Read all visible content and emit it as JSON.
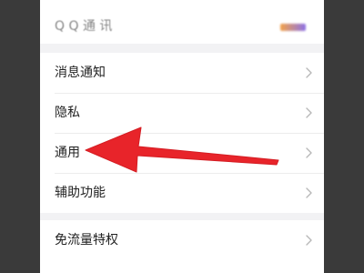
{
  "top_item": {
    "label": "Q Q 通 讯"
  },
  "menu": [
    {
      "label": "消息通知"
    },
    {
      "label": "隐私"
    },
    {
      "label": "通用"
    },
    {
      "label": "辅助功能"
    }
  ],
  "extra_item": {
    "label": "免流量特权"
  },
  "colors": {
    "arrow": "#e8242a",
    "chevron": "#b8b8b8"
  },
  "icons": {
    "chevron": "chevron-right-icon",
    "arrow": "annotation-arrow-icon"
  }
}
